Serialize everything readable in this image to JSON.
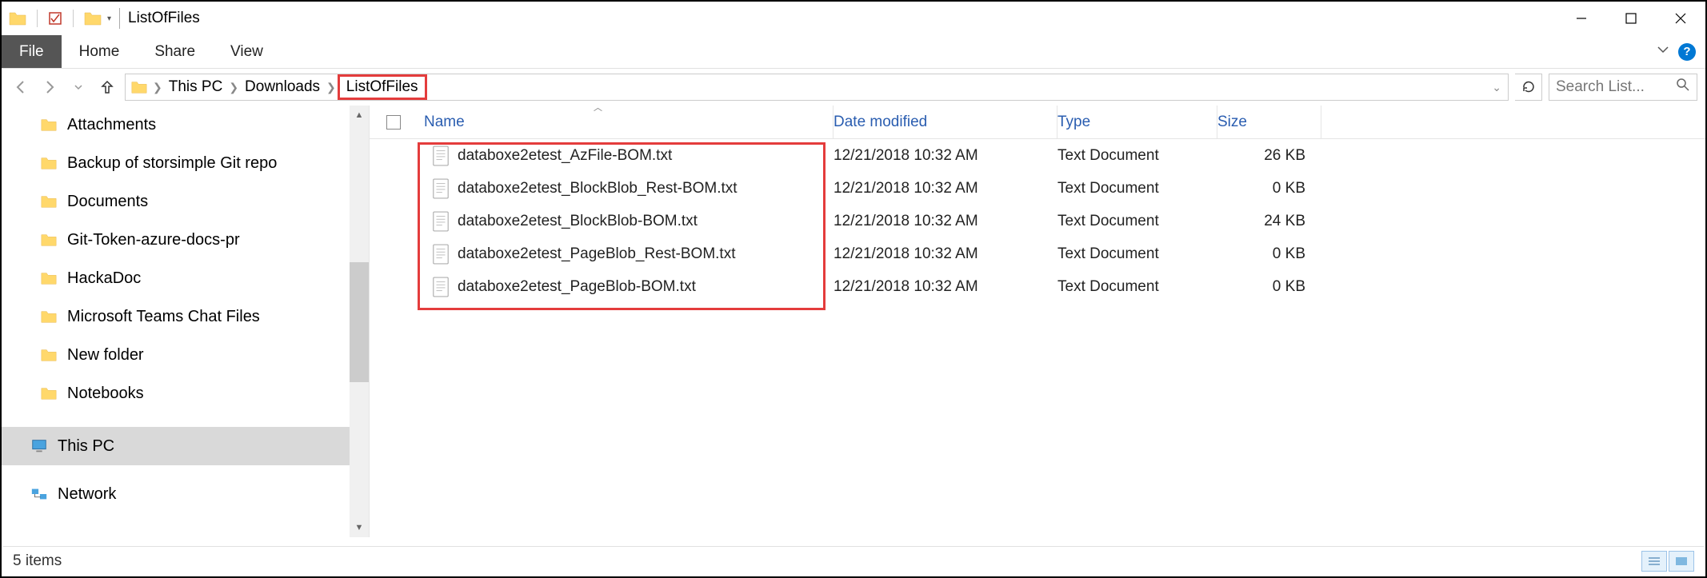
{
  "window": {
    "title": "ListOfFiles"
  },
  "ribbon": {
    "file": "File",
    "tabs": [
      "Home",
      "Share",
      "View"
    ]
  },
  "breadcrumb": {
    "items": [
      "This PC",
      "Downloads",
      "ListOfFiles"
    ],
    "highlighted_index": 2
  },
  "search": {
    "placeholder": "Search List..."
  },
  "navpane": {
    "folders": [
      "Attachments",
      "Backup of storsimple Git repo",
      "Documents",
      "Git-Token-azure-docs-pr",
      "HackaDoc",
      "Microsoft Teams Chat Files",
      "New folder",
      "Notebooks"
    ],
    "thispc": "This PC",
    "network": "Network"
  },
  "columns": {
    "name": "Name",
    "date": "Date modified",
    "type": "Type",
    "size": "Size"
  },
  "files": [
    {
      "name": "databoxe2etest_AzFile-BOM.txt",
      "date": "12/21/2018 10:32 AM",
      "type": "Text Document",
      "size": "26 KB"
    },
    {
      "name": "databoxe2etest_BlockBlob_Rest-BOM.txt",
      "date": "12/21/2018 10:32 AM",
      "type": "Text Document",
      "size": "0 KB"
    },
    {
      "name": "databoxe2etest_BlockBlob-BOM.txt",
      "date": "12/21/2018 10:32 AM",
      "type": "Text Document",
      "size": "24 KB"
    },
    {
      "name": "databoxe2etest_PageBlob_Rest-BOM.txt",
      "date": "12/21/2018 10:32 AM",
      "type": "Text Document",
      "size": "0 KB"
    },
    {
      "name": "databoxe2etest_PageBlob-BOM.txt",
      "date": "12/21/2018 10:32 AM",
      "type": "Text Document",
      "size": "0 KB"
    }
  ],
  "status": {
    "text": "5 items"
  }
}
